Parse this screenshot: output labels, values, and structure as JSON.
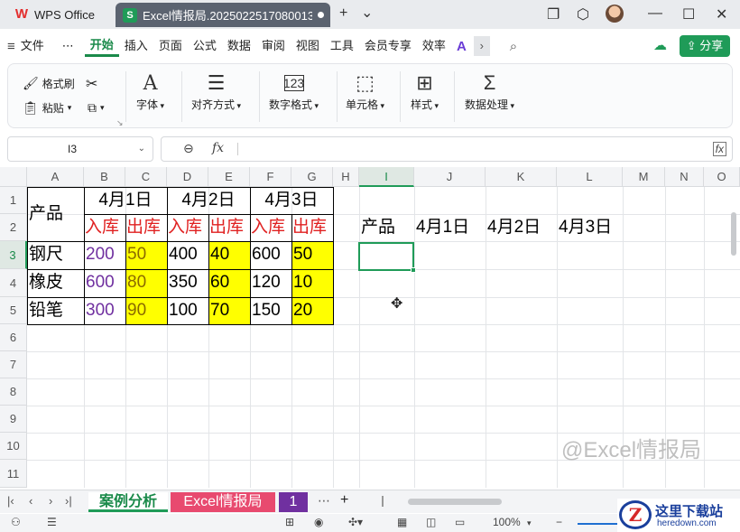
{
  "titlebar": {
    "app_tab": "WPS Office",
    "doc_tab": "Excel情报局.2025022517080013",
    "new_tab_symbol": "+",
    "dropdown_symbol": "⌄"
  },
  "menu": {
    "file": "文件",
    "more": "⋯",
    "tabs": [
      "开始",
      "插入",
      "页面",
      "公式",
      "数据",
      "审阅",
      "视图",
      "工具",
      "会员专享",
      "效率"
    ],
    "active_tab": "开始",
    "share": "分享"
  },
  "ribbon": {
    "format_painter": "格式刷",
    "paste": "粘贴",
    "font": "字体",
    "align": "对齐方式",
    "number_format": "数字格式",
    "cell": "单元格",
    "style": "样式",
    "data_process": "数据处理"
  },
  "formula": {
    "name_box": "I3",
    "fx": "fx",
    "content": ""
  },
  "columns": [
    "A",
    "B",
    "C",
    "D",
    "E",
    "F",
    "G",
    "H",
    "I",
    "J",
    "K",
    "L",
    "M",
    "N",
    "O"
  ],
  "rows": [
    "1",
    "2",
    "3",
    "4",
    "5",
    "6",
    "7",
    "8",
    "9",
    "10",
    "11"
  ],
  "selected_cell": "I3",
  "table": {
    "header_product": "产品",
    "dates": [
      "4月1日",
      "4月2日",
      "4月3日"
    ],
    "sub_headers": [
      "入库",
      "出库",
      "入库",
      "出库",
      "入库",
      "出库"
    ],
    "rows": [
      {
        "name": "钢尺",
        "values": [
          "200",
          "50",
          "400",
          "40",
          "600",
          "50"
        ]
      },
      {
        "name": "橡皮",
        "values": [
          "600",
          "80",
          "350",
          "60",
          "120",
          "10"
        ]
      },
      {
        "name": "铅笔",
        "values": [
          "300",
          "90",
          "100",
          "70",
          "150",
          "20"
        ]
      }
    ]
  },
  "result_header": {
    "product": "产品",
    "dates": [
      "4月1日",
      "4月2日",
      "4月3日"
    ]
  },
  "watermark": "@Excel情报局",
  "sheets": {
    "tabs": [
      "案例分析",
      "Excel情报局",
      "1"
    ],
    "active": "案例分析",
    "more": "⋯",
    "add": "+"
  },
  "status": {
    "zoom": "100%"
  },
  "site_logo": {
    "cn": "这里下载站",
    "en": "heredown.com"
  },
  "colors": {
    "accent_green": "#1f9b58",
    "yellow_fill": "#ffff00",
    "red_text": "#e02020",
    "purple_text": "#7030a0",
    "pink_tab": "#e84a6f",
    "purple_tab": "#7030a0"
  }
}
